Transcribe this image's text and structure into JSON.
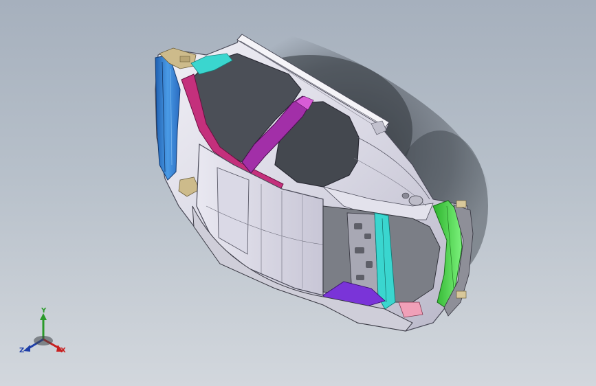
{
  "triad": {
    "x_label": "X",
    "y_label": "Y",
    "z_label": "Z",
    "x_color": "#c82020",
    "y_color": "#2a9a2a",
    "z_color": "#1f3fa8"
  },
  "colors": {
    "background_top": "#a6b0bd",
    "background_bottom": "#d2d7dd",
    "body_panel": "#dcdbe6",
    "pillar_blue": "#3a7fd0",
    "header_magenta": "#c0307a",
    "b_pillar_purple": "#a02fa6",
    "front_green": "#4dd84d",
    "cyan_part": "#3ad6cf",
    "tan_part": "#c8b88a",
    "floor_violet": "#7a34d8"
  }
}
